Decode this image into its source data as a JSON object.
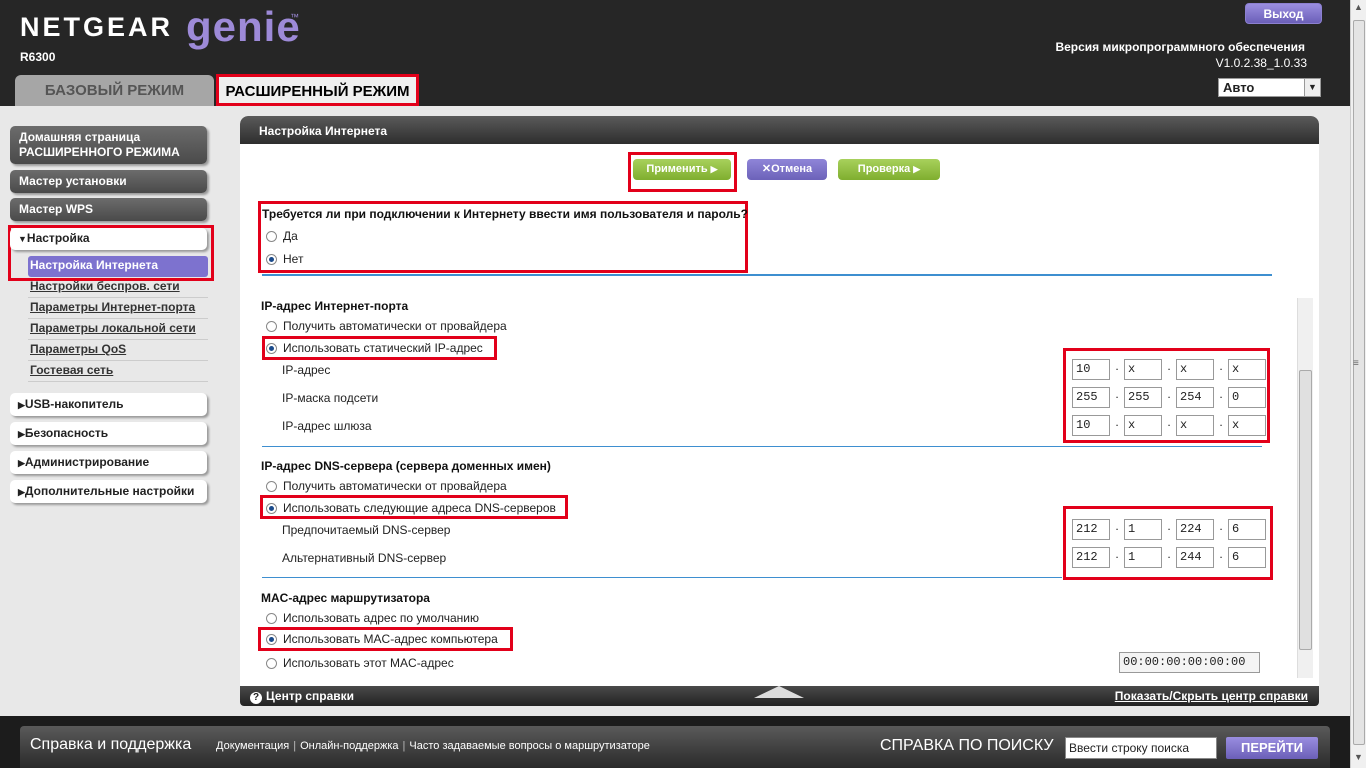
{
  "header": {
    "brand": "NETGEAR",
    "product": "genie",
    "trademark": "™",
    "model": "R6300",
    "logout_label": "Выход",
    "firmware_label": "Версия микропрограммного обеспечения",
    "firmware_version": "V1.0.2.38_1.0.33",
    "language_select": "Авто",
    "tabs": {
      "basic": "БАЗОВЫЙ РЕЖИМ",
      "advanced": "РАСШИРЕННЫЙ РЕЖИМ"
    }
  },
  "sidebar": {
    "home": "Домашняя страница РАСШИРЕННОГО РЕЖИМА",
    "setup_wizard": "Мастер установки",
    "wps_wizard": "Мастер WPS",
    "setup": "Настройка",
    "setup_items": [
      "Настройка Интернета",
      "Настройки беспров. сети",
      "Параметры Интернет-порта",
      "Параметры локальной сети",
      "Параметры QoS",
      "Гостевая сеть"
    ],
    "groups": [
      "USB-накопитель",
      "Безопасность",
      "Администрирование",
      "Дополнительные настройки"
    ]
  },
  "panel": {
    "title": "Настройка Интернета",
    "buttons": {
      "apply": "Применить",
      "cancel": "Отмена",
      "test": "Проверка"
    },
    "login_question": "Требуется ли при подключении к Интернету ввести имя пользователя и пароль?",
    "login_yes": "Да",
    "login_no": "Нет",
    "ip_section": "IP-адрес Интернет-порта",
    "ip_auto": "Получить автоматически от провайдера",
    "ip_static": "Использовать статический IP-адрес",
    "ip_address_label": "IP-адрес",
    "subnet_label": "IP-маска подсети",
    "gateway_label": "IP-адрес шлюза",
    "ip_address": [
      "10",
      "x",
      "x",
      "x"
    ],
    "subnet": [
      "255",
      "255",
      "254",
      "0"
    ],
    "gateway": [
      "10",
      "x",
      "x",
      "x"
    ],
    "dns_section": "IP-адрес DNS-сервера (сервера доменных имен)",
    "dns_auto": "Получить автоматически от провайдера",
    "dns_manual": "Использовать следующие адреса DNS-серверов",
    "dns_primary_label": "Предпочитаемый DNS-сервер",
    "dns_secondary_label": "Альтернативный DNS-сервер",
    "dns_primary": [
      "212",
      "1",
      "224",
      "6"
    ],
    "dns_secondary": [
      "212",
      "1",
      "244",
      "6"
    ],
    "mac_section": "MAC-адрес маршрутизатора",
    "mac_default": "Использовать адрес по умолчанию",
    "mac_computer": "Использовать MAC-адрес компьютера",
    "mac_this": "Использовать этот MAC-адрес",
    "mac_value": "00:00:00:00:00:00",
    "help_center": "Центр справки",
    "help_toggle": "Показать/Скрыть центр справки"
  },
  "footer": {
    "title": "Справка и поддержка",
    "links": [
      "Документация",
      "Онлайн-поддержка",
      "Часто задаваемые вопросы о маршрутизаторе"
    ],
    "search_label": "СПРАВКА ПО ПОИСКУ",
    "search_value": "Ввести строку поиска",
    "go_label": "ПЕРЕЙТИ"
  },
  "colors": {
    "accent": "#7d72cf",
    "highlight": "#e2001a",
    "green": "#8fbf3f"
  }
}
